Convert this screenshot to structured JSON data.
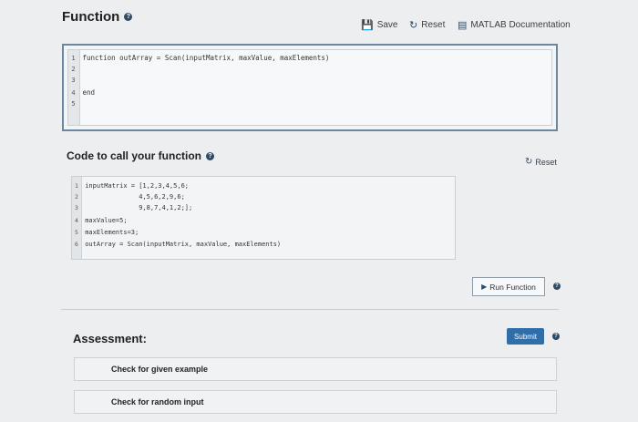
{
  "header": {
    "title": "Function",
    "save_label": "Save",
    "reset_label": "Reset",
    "docs_label": "MATLAB Documentation"
  },
  "editor": {
    "lines": [
      {
        "num": "1",
        "code": "function outArray = Scan(inputMatrix, maxValue, maxElements)"
      },
      {
        "num": "2",
        "code": ""
      },
      {
        "num": "3",
        "code": ""
      },
      {
        "num": "4",
        "code": "end"
      },
      {
        "num": "5",
        "code": ""
      }
    ]
  },
  "call_section": {
    "title": "Code to call your function",
    "reset_label": "Reset",
    "lines": [
      {
        "num": "1",
        "code": "inputMatrix = [1,2,3,4,5,6;"
      },
      {
        "num": "2",
        "code": "              4,5,6,2,9,6;"
      },
      {
        "num": "3",
        "code": "              9,8,7,4,1,2;];"
      },
      {
        "num": "4",
        "code": "maxValue=5;"
      },
      {
        "num": "5",
        "code": "maxElements=3;"
      },
      {
        "num": "6",
        "code": "outArray = Scan(inputMatrix, maxValue, maxElements)"
      }
    ],
    "run_label": "Run Function"
  },
  "assessment": {
    "title": "Assessment:",
    "submit_label": "Submit",
    "tests": [
      {
        "label": "Check for given example"
      },
      {
        "label": "Check for random input"
      }
    ]
  },
  "colors": {
    "accent": "#2f6ea8",
    "editor_border": "#6e87a0"
  }
}
